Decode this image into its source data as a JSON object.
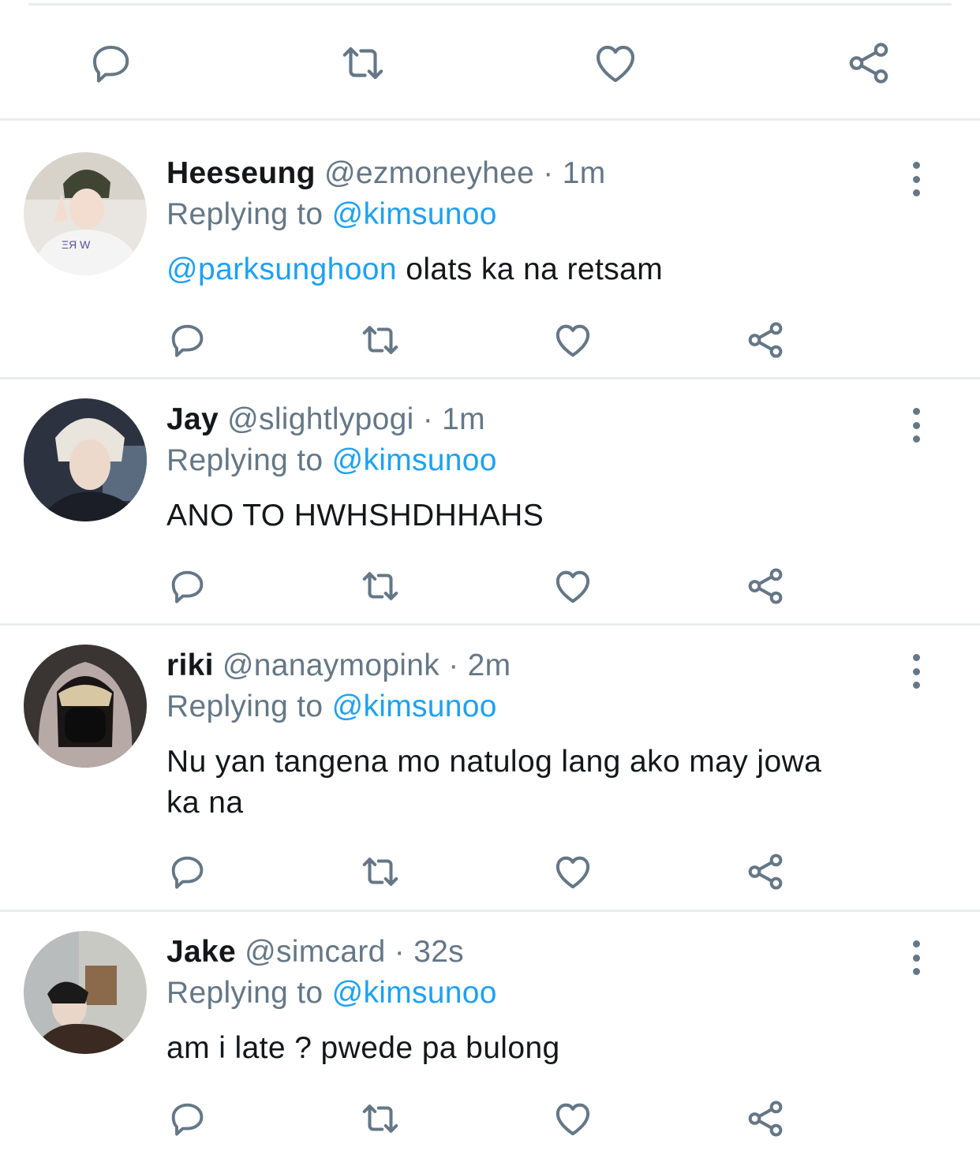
{
  "icons": {
    "reply": "reply-icon",
    "retweet": "retweet-icon",
    "like": "heart-icon",
    "share": "share-icon",
    "more": "more-vertical-icon"
  },
  "colors": {
    "icon": "#657786",
    "link": "#1da1f2",
    "text": "#14171a",
    "divider": "#e6ecf0"
  },
  "replies": [
    {
      "name": "Heeseung",
      "handle": "@ezmoneyhee",
      "dot": "·",
      "time": "1m",
      "replying_prefix": "Replying to",
      "replying_to": "@kimsunoo",
      "mention": "@parksunghoon",
      "text": " olats ka na retsam"
    },
    {
      "name": "Jay",
      "handle": "@slightlypogi",
      "dot": "·",
      "time": "1m",
      "replying_prefix": "Replying to",
      "replying_to": "@kimsunoo",
      "text": "ANO TO HWHSHDHHAHS"
    },
    {
      "name": "riki",
      "handle": "@nanaymopink",
      "dot": "·",
      "time": "2m",
      "replying_prefix": "Replying to",
      "replying_to": "@kimsunoo",
      "text_line1": "Nu yan tangena mo natulog lang ako may jowa",
      "text_line2": "ka na"
    },
    {
      "name": "Jake",
      "handle": "@simcard",
      "dot": "·",
      "time": "32s",
      "replying_prefix": "Replying to",
      "replying_to": "@kimsunoo",
      "text": "am i late ? pwede pa bulong"
    }
  ]
}
